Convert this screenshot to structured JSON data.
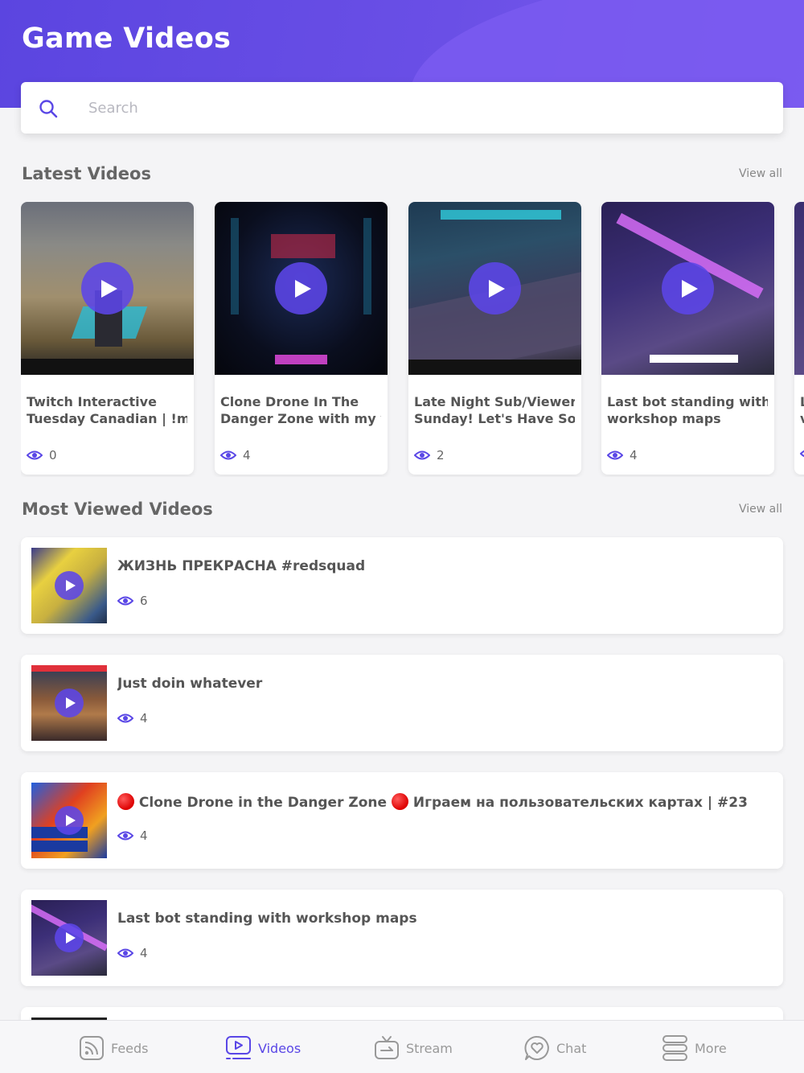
{
  "header": {
    "title": "Game Videos",
    "accent_color": "#5b45e0"
  },
  "search": {
    "placeholder": "Search",
    "value": ""
  },
  "latest": {
    "title": "Latest Videos",
    "view_all": "View all",
    "videos": [
      {
        "title_line1": "Twitch Interactive",
        "title_line2": "Tuesday Canadian | !m...",
        "views": "0"
      },
      {
        "title_line1": "Clone Drone In The",
        "title_line2": "Danger Zone with my v...",
        "views": "4"
      },
      {
        "title_line1": "Late Night Sub/Viewer",
        "title_line2": "Sunday! Let's Have So...",
        "views": "2"
      },
      {
        "title_line1": "Last bot standing with",
        "title_line2": "workshop maps",
        "views": "4"
      },
      {
        "title_line1": "L",
        "title_line2": "v",
        "views": ""
      }
    ]
  },
  "most_viewed": {
    "title": "Most Viewed Videos",
    "view_all": "View all",
    "videos": [
      {
        "title": "ЖИЗНЬ ПРЕКРАСНА #redsquad",
        "views": "6"
      },
      {
        "title": "Just doin whatever",
        "views": "4"
      },
      {
        "title_part1": "Clone Drone in the Danger Zone",
        "title_part2": "Играем на пользовательских картах | #23",
        "views": "4"
      },
      {
        "title": "Last bot standing with workshop maps",
        "views": "4"
      }
    ]
  },
  "nav": {
    "items": [
      {
        "label": "Feeds",
        "icon": "feeds-icon"
      },
      {
        "label": "Videos",
        "icon": "videos-icon"
      },
      {
        "label": "Stream",
        "icon": "stream-icon"
      },
      {
        "label": "Chat",
        "icon": "chat-icon"
      },
      {
        "label": "More",
        "icon": "more-icon"
      }
    ],
    "active": "Videos",
    "active_color": "#5a47e6",
    "inactive_color": "#999999"
  }
}
